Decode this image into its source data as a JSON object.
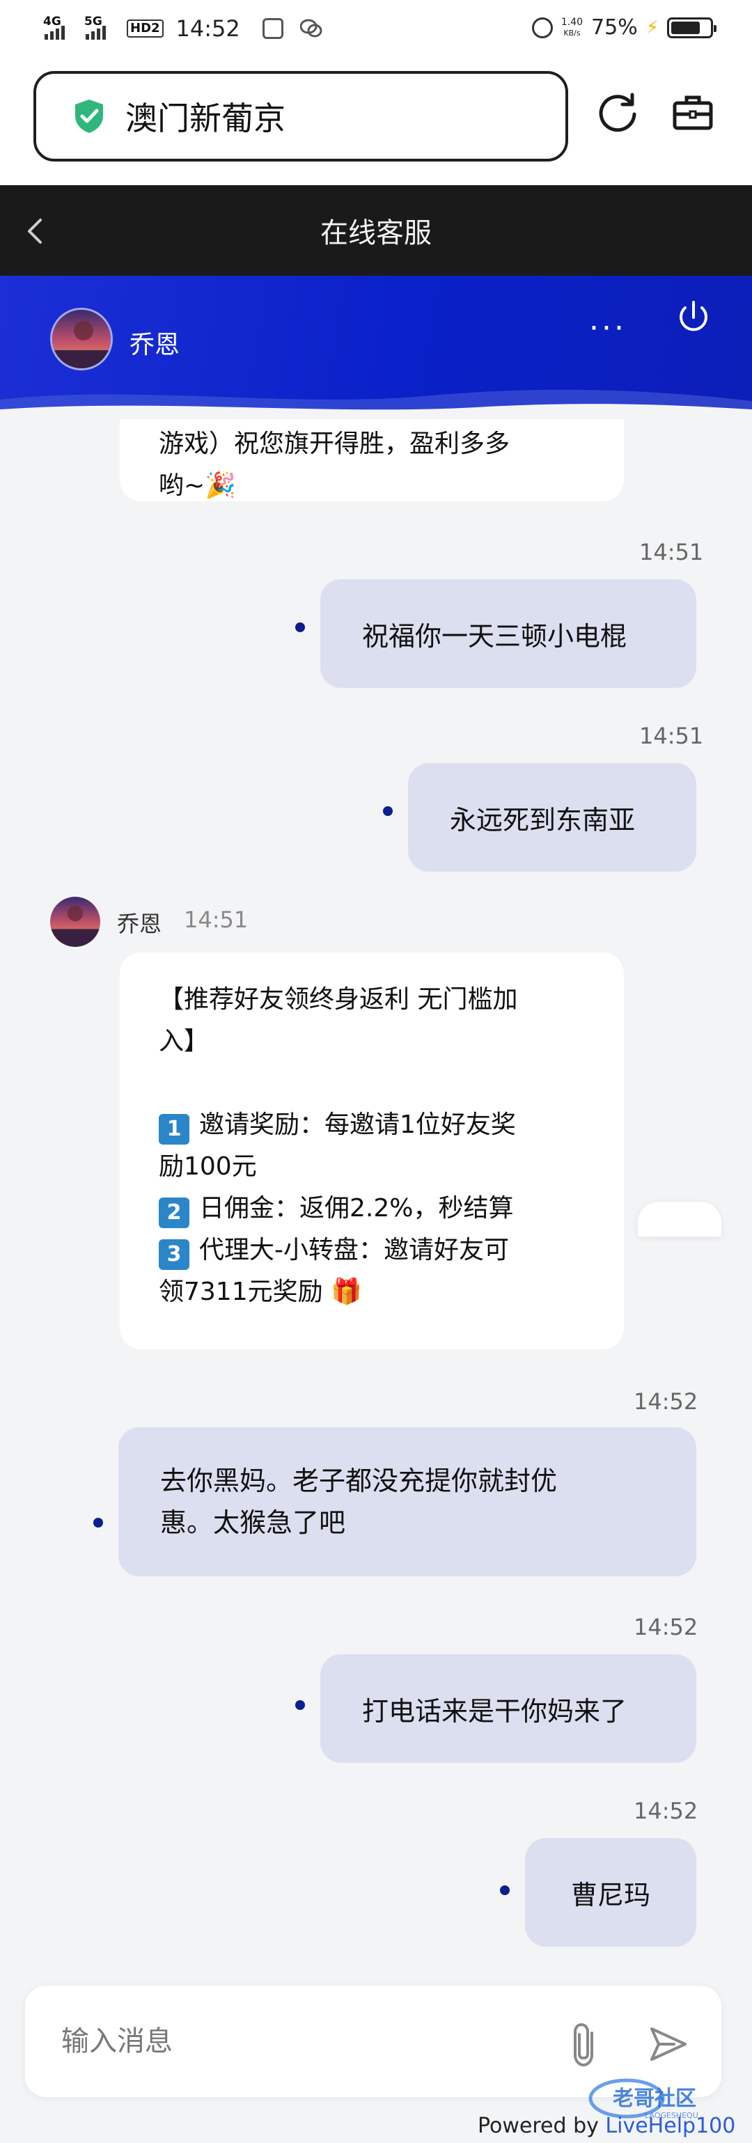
{
  "status_bar": {
    "net1": "4G",
    "net2": "5G",
    "hd": "HD2",
    "time": "14:52",
    "speed_value": "1.40",
    "speed_unit": "KB/s",
    "battery": "75%"
  },
  "browser": {
    "url_text": "澳门新葡京",
    "icons": [
      "shield-check-icon",
      "reload-icon",
      "toolbox-icon"
    ]
  },
  "nav": {
    "title": "在线客服"
  },
  "chat_header": {
    "agent_name": "乔恩",
    "more": "···",
    "colors": {
      "accent": "#0a20c8",
      "outgoing_bubble": "#dcdff0",
      "dot": "#0c1f8c"
    }
  },
  "messages": {
    "m0": {
      "direction": "in",
      "lines": [
        "游戏）祝您旗开得胜，盈利多多",
        "哟~🎉"
      ]
    },
    "m1": {
      "direction": "out",
      "time": "14:51",
      "text": "祝福你一天三顿小电棍"
    },
    "m2": {
      "direction": "out",
      "time": "14:51",
      "text": "永远死到东南亚"
    },
    "m3": {
      "direction": "in",
      "sender": "乔恩",
      "time": "14:51",
      "line1": "【推荐好友领终身返利 无门槛加",
      "line2": "入】",
      "b1": "1",
      "b1_line1": "邀请奖励：每邀请1位好友奖",
      "b1_line2": "励100元",
      "b2": "2",
      "b2_text": "日佣金：返佣2.2%，秒结算",
      "b3": "3",
      "b3_line1": "代理大-小转盘：邀请好友可",
      "b3_line2": "领7311元奖励 🎁"
    },
    "m4": {
      "direction": "out",
      "time": "14:52",
      "line1": "去你黑妈。老子都没充提你就封优",
      "line2": "惠。太猴急了吧"
    },
    "m5": {
      "direction": "out",
      "time": "14:52",
      "text": "打电话来是干你妈来了"
    },
    "m6": {
      "direction": "out",
      "time": "14:52",
      "text": "曹尼玛"
    }
  },
  "input": {
    "placeholder": "输入消息"
  },
  "footer": {
    "powered_prefix": "Powered by ",
    "powered_brand": "LiveHelp100",
    "watermark": "老哥社区",
    "watermark_sub": "LAOGESHEQU"
  }
}
